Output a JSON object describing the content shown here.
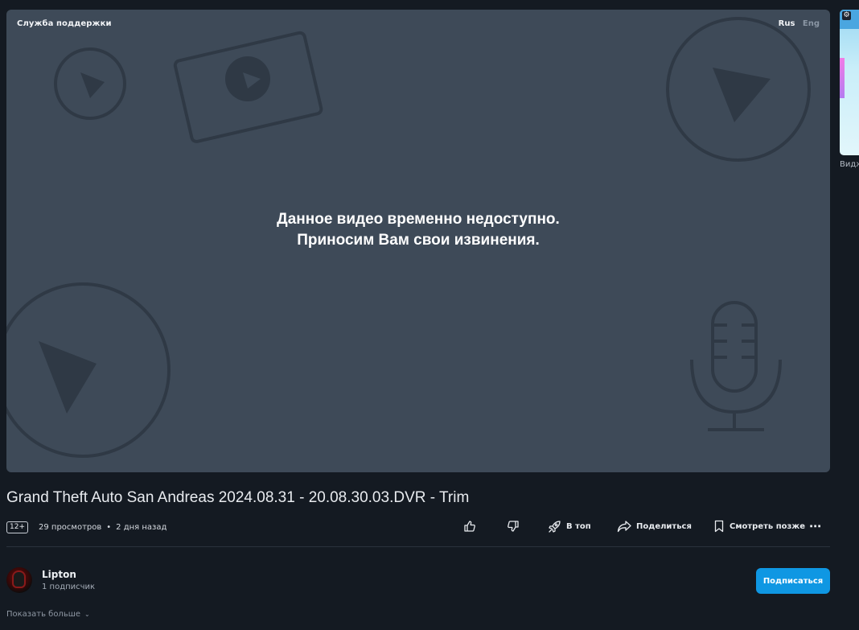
{
  "player": {
    "support_label": "Служба поддержки",
    "lang_active": "Rus",
    "lang_inactive": "Eng",
    "message": "Данное видео временно недоступно. Приносим Вам свои извинения."
  },
  "side_video": {
    "label": "Видж"
  },
  "video": {
    "title": "Grand Theft Auto San Andreas 2024.08.31 - 20.08.30.03.DVR - Trim",
    "age_rating": "12+",
    "views": "29 просмотров",
    "separator": "•",
    "date": "2 дня назад"
  },
  "actions": {
    "to_top": "В топ",
    "share": "Поделиться",
    "watch_later": "Смотреть позже",
    "more": "⋯"
  },
  "channel": {
    "name": "Lipton",
    "subscribers": "1 подписчик",
    "subscribe_label": "Подписаться"
  },
  "description": {
    "show_more": "Показать больше",
    "chevron": "⌄"
  }
}
